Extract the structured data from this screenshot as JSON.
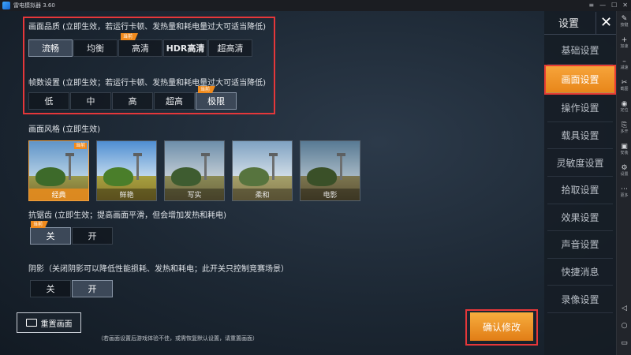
{
  "titlebar": {
    "title": "雷电模拟器 3.60",
    "controls": [
      "≡",
      "—",
      "☐",
      "✕"
    ]
  },
  "side": {
    "title": "设置",
    "close": "✕",
    "items": [
      "基础设置",
      "画面设置",
      "操作设置",
      "载具设置",
      "灵敏度设置",
      "拾取设置",
      "效果设置",
      "声音设置",
      "快捷消息",
      "录像设置"
    ],
    "active_index": 1
  },
  "quality": {
    "title": "画面品质 (立即生效，若运行卡顿、发热量和耗电量过大可适当降低)",
    "options": [
      "流畅",
      "均衡",
      "高清",
      "HDR高清",
      "超高清"
    ],
    "selected": "流畅",
    "current_tag": "当前",
    "current_option": "高清"
  },
  "fps": {
    "title": "帧数设置 (立即生效；若运行卡顿、发热量和耗电量过大可适当降低)",
    "options": [
      "低",
      "中",
      "高",
      "超高",
      "极限"
    ],
    "selected": "极限",
    "current_tag": "当前"
  },
  "style": {
    "title": "画面风格 (立即生效)",
    "options": [
      "经典",
      "鲜艳",
      "写实",
      "柔和",
      "电影"
    ],
    "selected": "经典",
    "current_tag": "当前"
  },
  "antialias": {
    "title": "抗锯齿 (立即生效；提高画面平滑，但会增加发热和耗电)",
    "options": [
      "关",
      "开"
    ],
    "selected": "关",
    "current_tag": "当前"
  },
  "shadow": {
    "title": "阴影（关闭阴影可以降低性能损耗、发热和耗电；此开关只控制竞赛场景）",
    "options": [
      "关",
      "开"
    ],
    "selected": "开"
  },
  "bottom": {
    "reset_label": "重置画面",
    "hint": "（若画面设置后游戏体验不佳，或需恢复默认设置，请重置画面）",
    "confirm_label": "确认修改"
  },
  "emu_toolbar": [
    {
      "icon": "✎",
      "label": "按键"
    },
    {
      "icon": "+",
      "label": "加速"
    },
    {
      "icon": "–",
      "label": "减速"
    },
    {
      "icon": "✂",
      "label": "截图"
    },
    {
      "icon": "◉",
      "label": "定位"
    },
    {
      "icon": "⎘",
      "label": "多开"
    },
    {
      "icon": "▣",
      "label": "安装"
    },
    {
      "icon": "⚙",
      "label": "设置"
    },
    {
      "icon": "⋯",
      "label": "更多"
    }
  ],
  "emu_bottom": [
    "◁",
    "○",
    "▭"
  ],
  "colors": {
    "accent": "#f08a1c",
    "highlight_border": "#e5373a",
    "panel": "#161c24"
  }
}
